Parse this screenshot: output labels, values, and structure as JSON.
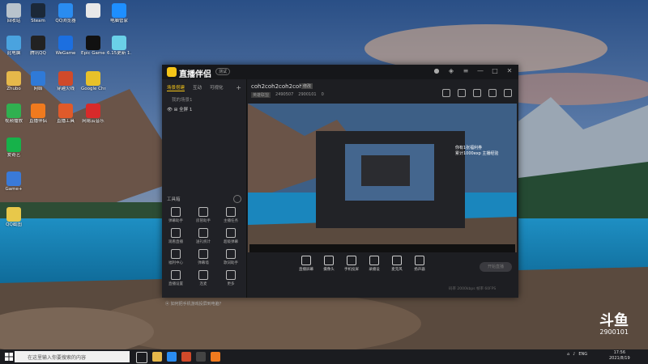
{
  "desktop": {
    "icons": [
      {
        "name": "recycle-bin-icon",
        "label": "回收站",
        "color": "#b8c3cc"
      },
      {
        "name": "steam-icon",
        "label": "Steam",
        "color": "#1b2838"
      },
      {
        "name": "qq-browser-icon",
        "label": "QQ浏览器",
        "color": "#2a8cf0"
      },
      {
        "name": "document-icon",
        "label": "",
        "color": "#e8e8e8"
      },
      {
        "name": "security-icon",
        "label": "电脑管家",
        "color": "#1e8fff"
      },
      {
        "name": "computer-icon",
        "label": "此电脑",
        "color": "#4aa3df"
      },
      {
        "name": "qq-icon",
        "label": "腾讯QQ",
        "color": "#222"
      },
      {
        "name": "wegame-icon",
        "label": "WeGame",
        "color": "#1c6fe0"
      },
      {
        "name": "epic-icon",
        "label": "Epic Games Launcher",
        "color": "#111"
      },
      {
        "name": "update-icon",
        "label": "6.15更新 1.4",
        "color": "#6ad0e8"
      },
      {
        "name": "folder-icon",
        "label": "Zhubo",
        "color": "#e6b84a"
      },
      {
        "name": "network-icon",
        "label": "网络",
        "color": "#2f7ad8"
      },
      {
        "name": "game-icon",
        "label": "穿越火线",
        "color": "#d04a2a"
      },
      {
        "name": "chrome-icon",
        "label": "Google Chrome",
        "color": "#e8c12a"
      },
      {
        "name": "player-icon",
        "label": "视频播放",
        "color": "#30b050"
      },
      {
        "name": "live-icon",
        "label": "直播伴侣",
        "color": "#f07a1e"
      },
      {
        "name": "tool-icon",
        "label": "直播工具",
        "color": "#e05a2a"
      },
      {
        "name": "netease-icon",
        "label": "网易云音乐",
        "color": "#d82a2a"
      },
      {
        "name": "iqiyi-icon",
        "label": "爱奇艺",
        "color": "#16b24a"
      },
      {
        "name": "control-panel-icon",
        "label": "Game+",
        "color": "#3a7ad8"
      },
      {
        "name": "file-icon",
        "label": "QQ截图",
        "color": "#e8c84a"
      }
    ]
  },
  "app": {
    "brand": "直播伴侣",
    "version_badge": "测试",
    "left": {
      "tabs": [
        "场景搭建",
        "互动",
        "可视化"
      ],
      "scene_item": "我的场景1",
      "layer_item": "全屏 1",
      "tools_title": "工具箱",
      "tools": [
        "弹幕助手",
        "房管助手",
        "主播任务",
        "观看直播",
        "送礼统计",
        "超级弹幕",
        "福利中心",
        "弹幕墙",
        "歌词助手",
        "直播设置",
        "连麦",
        "更多"
      ],
      "hint": "如何把手机游戏投屏到电脑？"
    },
    "main": {
      "room_title": "coh2coh2coh2coh2",
      "edit_label": "修改",
      "category": "英雄联盟",
      "room_id": "2490507",
      "fans": "2900101",
      "viewers": "0",
      "overlay_line1": "你有1张福利券",
      "overlay_line2": "累计1000exp 主播经验",
      "controls": [
        "直播屏幕",
        "摄像头",
        "手机投屏",
        "录播设",
        "麦克风",
        "扬声器"
      ],
      "start_label": "开始直播",
      "status": "码率 2000kbps  帧率 60FPS"
    }
  },
  "taskbar": {
    "search_placeholder": "在这里输入你要搜索的内容",
    "lang": "ENG",
    "time": "17:56",
    "date": "2021/8/19"
  },
  "watermark": {
    "logo": "斗鱼",
    "room": "2900101"
  }
}
